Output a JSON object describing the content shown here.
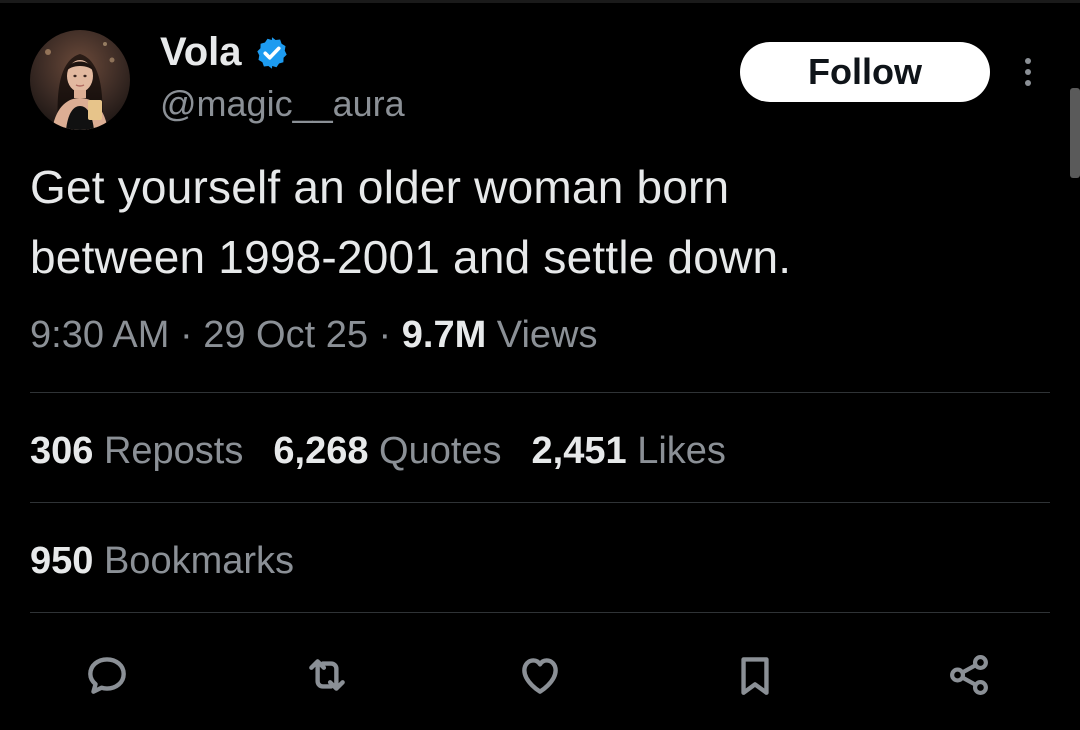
{
  "author": {
    "display_name": "Vola",
    "handle": "@magic__aura",
    "avatar_icon": "profile-photo",
    "verified_icon": "verified-badge-icon",
    "verified_color": "#1d9bf0"
  },
  "follow_label": "Follow",
  "more_icon": "more-vertical-icon",
  "tweet": {
    "line1": "Get yourself an older woman born",
    "line2": "between 1998-2001 and settle down."
  },
  "meta": {
    "time": "9:30 AM",
    "sep1": " · ",
    "date": "29 Oct 25",
    "sep2": " · ",
    "views_count": "9.7M",
    "views_label": " Views"
  },
  "stats": {
    "reposts_count": "306",
    "reposts_label": " Reposts",
    "quotes_count": "6,268",
    "quotes_label": " Quotes",
    "likes_count": "2,451",
    "likes_label": " Likes",
    "bookmarks_count": "950",
    "bookmarks_label": " Bookmarks"
  },
  "actions": [
    "reply-icon",
    "repost-icon",
    "like-icon",
    "bookmark-icon",
    "share-icon"
  ],
  "colors": {
    "background": "#000000",
    "text_primary": "#e7e9ea",
    "text_secondary": "#8b9096",
    "divider": "#2f3336",
    "follow_bg": "#ffffff",
    "follow_text": "#0f1419"
  }
}
